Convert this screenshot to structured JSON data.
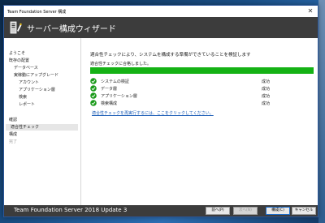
{
  "window": {
    "title": "Team Foundation Server 構成",
    "close_glyph": "✕",
    "header_title": "サーバー構成ウィザード",
    "header_icon": "server-wizard-icon"
  },
  "sidebar": {
    "items": [
      {
        "label": "ようこそ",
        "state": "normal"
      },
      {
        "label": "既存の配置",
        "state": "normal"
      },
      {
        "label": "データベース",
        "state": "normal"
      },
      {
        "label": "実稼動にアップグレード",
        "state": "normal"
      },
      {
        "label": "アカウント",
        "state": "normal"
      },
      {
        "label": "アプリケーション層",
        "state": "normal"
      },
      {
        "label": "検索",
        "state": "normal"
      },
      {
        "label": "レポート",
        "state": "normal"
      },
      {
        "label": "確認",
        "state": "normal"
      },
      {
        "label": "適合性チェック",
        "state": "selected"
      },
      {
        "label": "構成",
        "state": "normal"
      },
      {
        "label": "完了",
        "state": "disabled"
      }
    ]
  },
  "main": {
    "intro": "適合性チェックにより、システムを構成する準備ができていることを検証します",
    "progress_label": "適合性チェックに合格しました。",
    "progress_fraction": 1.0,
    "progress_color": "#15b215",
    "checks": [
      {
        "name": "システムの検証",
        "status": "成功",
        "icon": "success-check-icon"
      },
      {
        "name": "データ層",
        "status": "成功",
        "icon": "success-check-icon"
      },
      {
        "name": "アプリケーション層",
        "status": "成功",
        "icon": "success-check-icon"
      },
      {
        "name": "検索構成",
        "status": "成功",
        "icon": "success-check-icon"
      }
    ],
    "rerun_link": "適合性チェックを再実行するには、ここをクリックしてください。"
  },
  "footer": {
    "product": "Team Foundation Server 2018 Update 3",
    "buttons": {
      "previous": "前へ(P)",
      "next": "次へ(N)",
      "configure": "構成(C)",
      "cancel": "キャンセル"
    }
  }
}
